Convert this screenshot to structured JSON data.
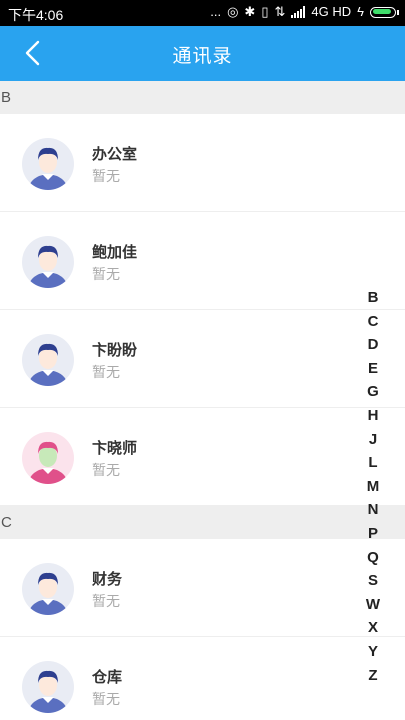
{
  "status_bar": {
    "time": "下午4:06",
    "dots": "...",
    "network": "4G HD"
  },
  "nav": {
    "title": "通讯录"
  },
  "sections": [
    {
      "letter": "B",
      "contacts": [
        {
          "name": "办公室",
          "sub": "暂无",
          "avatar": "male"
        },
        {
          "name": "鲍加佳",
          "sub": "暂无",
          "avatar": "male"
        },
        {
          "name": "卞盼盼",
          "sub": "暂无",
          "avatar": "male"
        },
        {
          "name": "卞晓师",
          "sub": "暂无",
          "avatar": "female"
        }
      ]
    },
    {
      "letter": "C",
      "contacts": [
        {
          "name": "财务",
          "sub": "暂无",
          "avatar": "male"
        },
        {
          "name": "仓库",
          "sub": "暂无",
          "avatar": "male"
        }
      ]
    }
  ],
  "index_letters": [
    "B",
    "C",
    "D",
    "E",
    "G",
    "H",
    "J",
    "L",
    "M",
    "N",
    "P",
    "Q",
    "S",
    "W",
    "X",
    "Y",
    "Z"
  ],
  "colors": {
    "accent": "#29a3ef",
    "male_bg": "#e9ecf4",
    "male_shirt": "#5a6fc0",
    "female_bg": "#fbe3ec",
    "female_shirt": "#e0508a"
  }
}
